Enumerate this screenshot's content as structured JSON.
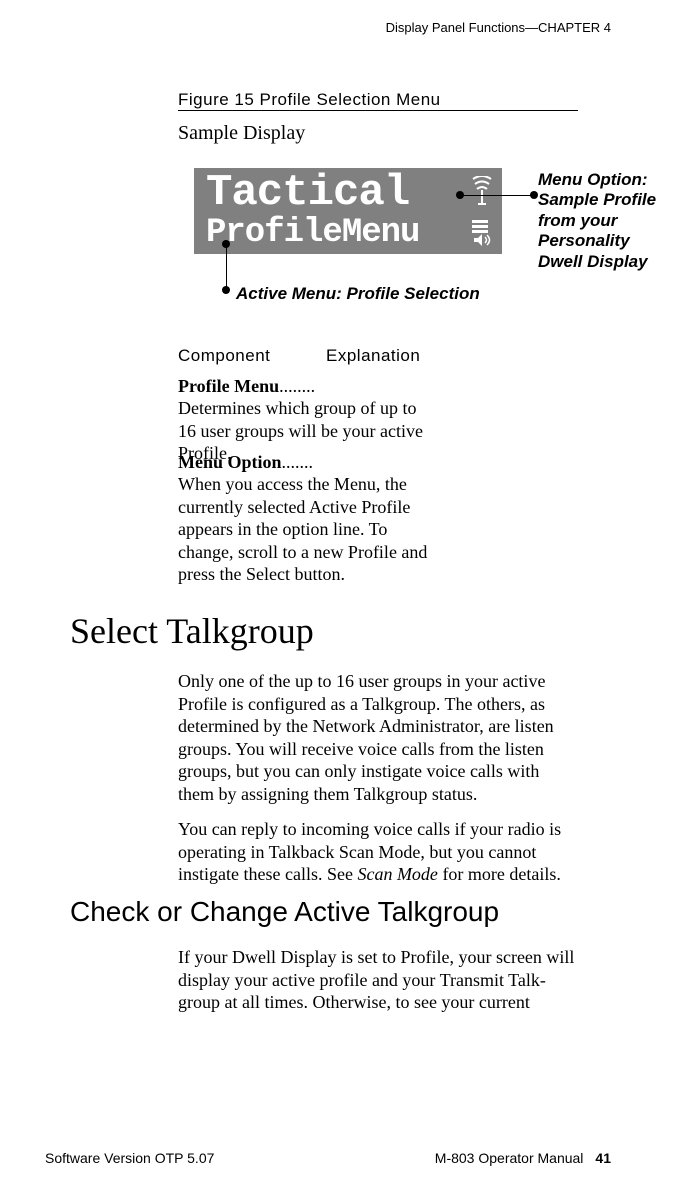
{
  "header": {
    "right": "Display Panel Functions—CHAPTER 4"
  },
  "figure": {
    "title": "Figure 15 Profile Selection Menu",
    "sample_label": "Sample Display",
    "display_line1": "Tactical",
    "display_line2": "ProfileMenu",
    "annotation_right": "Menu Option: Sample Profile from your Personality Dwell Display",
    "annotation_bottom": "Active Menu: Profile Selection"
  },
  "table": {
    "head_component": "Component",
    "head_explanation": "Explanation",
    "rows": [
      {
        "component_bold": "Profile Menu",
        "component_dots": "........",
        "explanation": "Determines which group of up to 16 user groups will be your active Profile."
      },
      {
        "component_bold": "Menu Option",
        "component_dots": ".......",
        "explanation": "When you access the Menu, the currently selected Active Profile appears in the option line. To change, scroll to a new Profile and press the Select button."
      }
    ]
  },
  "sections": {
    "heading1": "Select Talkgroup",
    "para1": "Only one of the up to 16 user groups in your active Profile is configured as a Talkgroup. The others, as determined by the Network Administrator, are listen groups. You will receive voice calls from the listen groups, but you can only instigate voice calls with them by assigning them Talkgroup status.",
    "para2_pre": "You can reply to incoming voice calls if your radio is operating in Talkback Scan Mode, but you cannot instigate these calls. See ",
    "para2_italic": "Scan Mode",
    "para2_post": " for more details.",
    "heading2": "Check or Change Active Talkgroup",
    "para3": "If your Dwell Display is set to Profile, your screen will display your active profile and your Transmit Talk-group at all times. Otherwise, to see your current"
  },
  "footer": {
    "left": "Software Version OTP 5.07",
    "right_label": "M-803 Operator Manual",
    "page": "41"
  }
}
